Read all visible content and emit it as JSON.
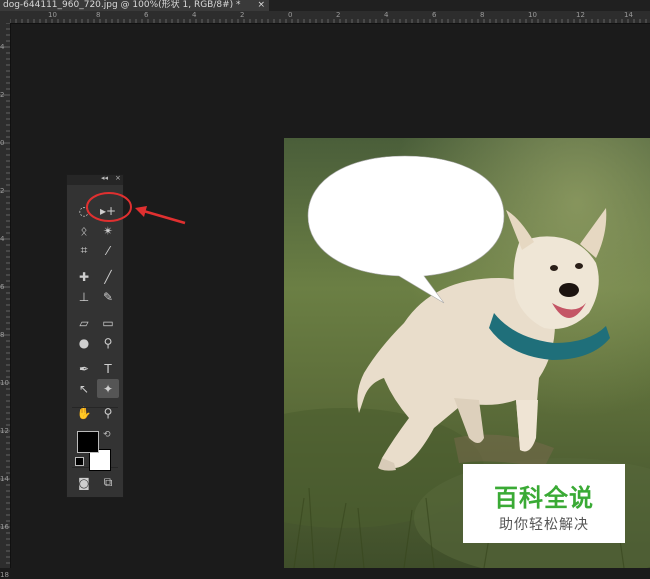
{
  "document_tab": {
    "title": "dog-644111_960_720.jpg @ 100%(形状 1, RGB/8#) *",
    "close_glyph": "×"
  },
  "ruler_top_labels": [
    "10",
    "8",
    "6",
    "4",
    "2",
    "0",
    "2",
    "4",
    "6",
    "8",
    "10",
    "12",
    "14"
  ],
  "ruler_left_labels": [
    "4",
    "2",
    "0",
    "2",
    "4",
    "6",
    "8",
    "10",
    "12",
    "14",
    "16",
    "18"
  ],
  "toolbox": {
    "collapse_glyph": "◂◂",
    "close_glyph": "×",
    "tools": [
      {
        "name": "elliptical-marquee-icon",
        "glyph": "◌"
      },
      {
        "name": "move-tool-icon",
        "glyph": "▸+"
      },
      {
        "name": "lasso-icon",
        "glyph": "ᛟ"
      },
      {
        "name": "magic-wand-icon",
        "glyph": "✴"
      },
      {
        "name": "crop-icon",
        "glyph": "⌗"
      },
      {
        "name": "eyedropper-icon",
        "glyph": "⁄"
      },
      {
        "name": "healing-brush-icon",
        "glyph": "✚"
      },
      {
        "name": "brush-icon",
        "glyph": "╱"
      },
      {
        "name": "clone-stamp-icon",
        "glyph": "⊥"
      },
      {
        "name": "history-brush-icon",
        "glyph": "✎"
      },
      {
        "name": "eraser-icon",
        "glyph": "▱"
      },
      {
        "name": "gradient-icon",
        "glyph": "▭"
      },
      {
        "name": "blur-icon",
        "glyph": "●"
      },
      {
        "name": "dodge-icon",
        "glyph": "⚲"
      },
      {
        "name": "pen-icon",
        "glyph": "✒"
      },
      {
        "name": "type-icon",
        "glyph": "T"
      },
      {
        "name": "path-selection-icon",
        "glyph": "↖"
      },
      {
        "name": "custom-shape-icon",
        "glyph": "✦"
      },
      {
        "name": "hand-icon",
        "glyph": "✋"
      },
      {
        "name": "zoom-icon",
        "glyph": "⚲"
      },
      {
        "name": "quick-mask-icon",
        "glyph": "◙"
      },
      {
        "name": "screen-mode-icon",
        "glyph": "⧉"
      }
    ]
  },
  "watermark": {
    "title": "百科全说",
    "subtitle": "助你轻松解决"
  },
  "colors": {
    "accent": "#3aaa35",
    "annotation": "#e03030"
  }
}
